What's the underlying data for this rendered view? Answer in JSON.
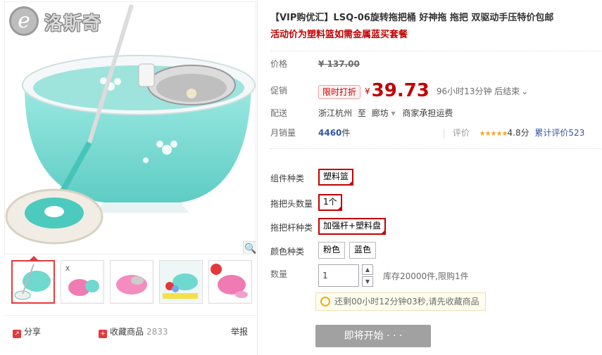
{
  "brand": {
    "logo_text": "洛斯奇",
    "logo_mark": "e"
  },
  "product": {
    "title": "【VIP购优汇】LSQ-06旋转拖把桶 好神拖 拖把 双驱动手压特价包邮",
    "subtitle": "活动价为塑料篮如需金属蓝买套餐"
  },
  "meta": {
    "price_label": "价格",
    "original_price": "¥ 137.00",
    "promo_label": "促销",
    "promo_tag": "限时打折",
    "currency": "¥",
    "promo_price": "39.73",
    "countdown": "96小时13分钟 后结束",
    "countdown_caret": "⌄",
    "ship_label": "配送",
    "ship_from": "浙江杭州",
    "ship_to_word": "至",
    "ship_to": "廊坊",
    "ship_caret": "▾",
    "ship_fee": "商家承担运费",
    "sales_label": "月销量",
    "sales_count": "4460",
    "sales_unit": "件",
    "rating_label": "评价",
    "stars": "★★★★★",
    "rating_score": "4.8分",
    "reviews_link": "累计评价523"
  },
  "sku": {
    "groups": [
      {
        "label": "组件种类",
        "options": [
          "塑料篮"
        ]
      },
      {
        "label": "拖把头数量",
        "options": [
          "1个"
        ]
      },
      {
        "label": "拖把杆种类",
        "options": [
          "加强杆+塑料盘"
        ]
      },
      {
        "label": "颜色种类",
        "options": [
          "粉色",
          "蓝色"
        ]
      }
    ]
  },
  "quantity": {
    "label": "数量",
    "value": "1",
    "up": "▲",
    "down": "▼",
    "stock_text": "库存20000件,限购1件"
  },
  "tip": {
    "text": "还剩00小时12分钟03秒,请先收藏商品"
  },
  "buy_button": {
    "label": "即将开始 · · ·"
  },
  "gallery_footer": {
    "share": "分享",
    "favorite": "收藏商品",
    "favorite_count": "2833",
    "report": "举报"
  },
  "colors": {
    "accent": "#c40000",
    "link": "#3355a4",
    "bucket": "#6fd8cf",
    "button_disabled": "#a1a1a1"
  }
}
